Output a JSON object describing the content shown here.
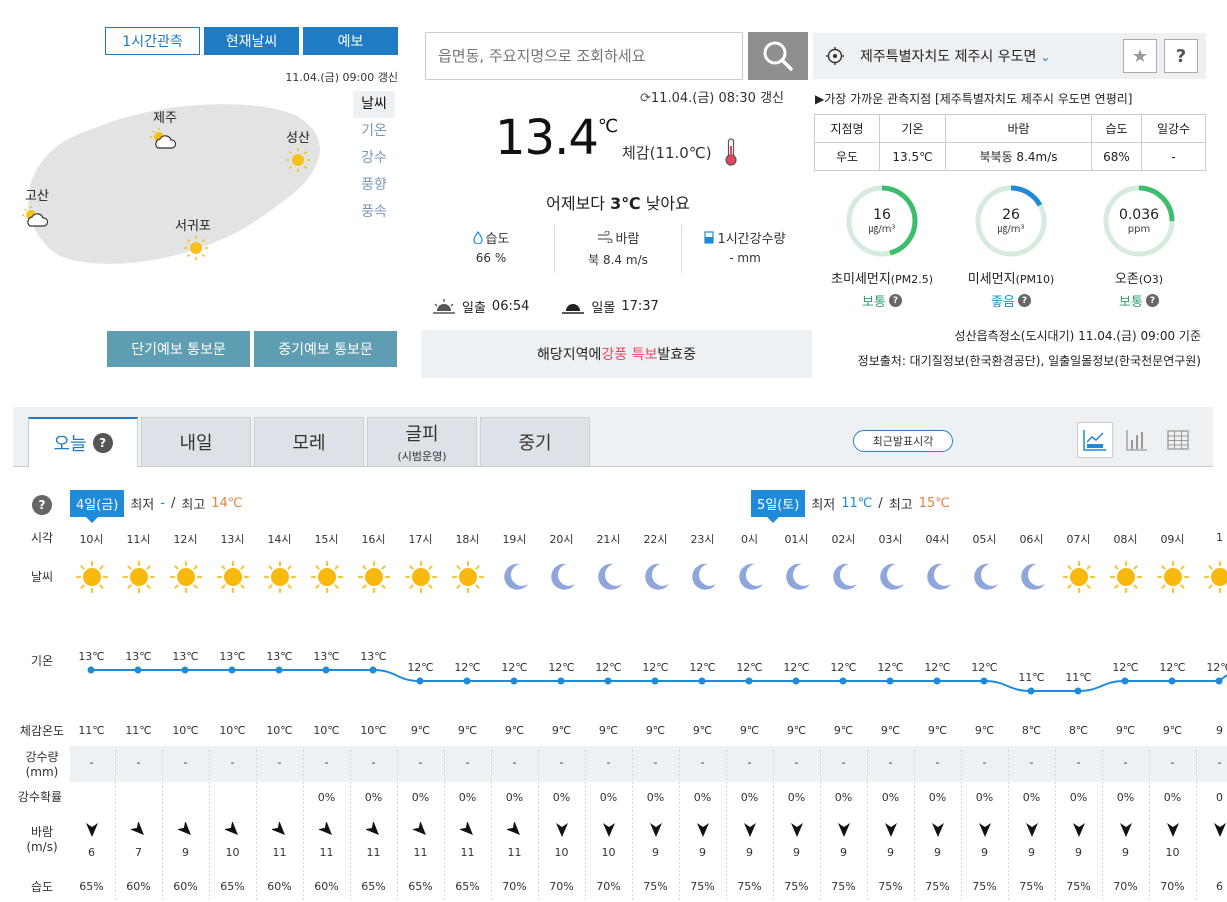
{
  "map": {
    "view_tabs": [
      "1시간관측",
      "현재날씨",
      "예보"
    ],
    "updated": "11.04.(금) 09:00 갱신",
    "locations": [
      {
        "name": "제주",
        "icon": "partly-cloudy-icon"
      },
      {
        "name": "성산",
        "icon": "sun-icon"
      },
      {
        "name": "고산",
        "icon": "partly-cloudy-icon"
      },
      {
        "name": "서귀포",
        "icon": "sun-icon"
      }
    ],
    "layers": [
      "날씨",
      "기온",
      "강수",
      "풍향",
      "풍속"
    ],
    "buttons": [
      "단기예보 통보문",
      "중기예보 통보문"
    ]
  },
  "search": {
    "placeholder": "읍면동, 주요지명으로 조회하세요"
  },
  "current": {
    "updated": "11.04.(금) 08:30 갱신",
    "temp": "13.4",
    "unit": "℃",
    "feels": "체감(11.0℃)",
    "compare_prefix": "어제보다 ",
    "compare_value": "3℃",
    "compare_suffix": " 낮아요",
    "metrics": [
      {
        "label": "습도",
        "value": "66 %",
        "icon": "drop-icon"
      },
      {
        "label": "바람",
        "value": "북 8.4 m/s",
        "icon": "wind-icon"
      },
      {
        "label": "1시간강수량",
        "value": "- mm",
        "icon": "rain-gauge-icon"
      }
    ],
    "sunrise_label": "일출",
    "sunrise": "06:54",
    "sunset_label": "일몰",
    "sunset": "17:37",
    "notice_prefix": "해당지역에 ",
    "notice_highlight": "강풍 특보",
    "notice_suffix": " 발효중"
  },
  "location_bar": {
    "name": "제주특별자치도 제주시 우도면",
    "star": "★",
    "help": "?"
  },
  "observation": {
    "nearest": "▶가장 가까운 관측지점 [제주특별자치도 제주시 우도면 연평리]",
    "headers": [
      "지점명",
      "기온",
      "바람",
      "습도",
      "일강수"
    ],
    "values": [
      "우도",
      "13.5℃",
      "북북동 8.4m/s",
      "68%",
      "-"
    ]
  },
  "air": [
    {
      "value": "16",
      "unit": "㎍/m³",
      "name": "초미세먼지",
      "sub": "(PM2.5)",
      "status": "보통",
      "status_color": "#2e9e6b",
      "ring_color": "#3ebd6d",
      "fraction": 0.46
    },
    {
      "value": "26",
      "unit": "㎍/m³",
      "name": "미세먼지",
      "sub": "(PM10)",
      "status": "좋음",
      "status_color": "#1e8ad8",
      "ring_color": "#1e8ad8",
      "fraction": 0.17
    },
    {
      "value": "0.036",
      "unit": "ppm",
      "name": "오존",
      "sub": "(O3)",
      "status": "보통",
      "status_color": "#2e9e6b",
      "ring_color": "#3ebd6d",
      "fraction": 0.25
    }
  ],
  "air_base": "성산읍측정소(도시대기) 11.04.(금) 09:00 기준",
  "air_source": "정보출처: 대기질정보(한국환경공단), 일출일몰정보(한국천문연구원)",
  "forecast_tabs": [
    {
      "label": "오늘",
      "sub": ""
    },
    {
      "label": "내일",
      "sub": ""
    },
    {
      "label": "모레",
      "sub": ""
    },
    {
      "label": "글피",
      "sub": "(시범운영)"
    },
    {
      "label": "중기",
      "sub": ""
    }
  ],
  "recent_button": "최근발표시각",
  "days": [
    {
      "label": "4일(금)",
      "min_label": "최저",
      "min": "-",
      "max_label": "최고",
      "max": "14℃"
    },
    {
      "label": "5일(토)",
      "min_label": "최저",
      "min": "11℃",
      "max_label": "최고",
      "max": "15℃"
    }
  ],
  "row_labels": {
    "time": "시각",
    "weather": "날씨",
    "temp": "기온",
    "feels": "체감온도",
    "rain": "강수량",
    "rain_unit": "(mm)",
    "prob": "강수확률",
    "wind": "바람",
    "wind_unit": "(m/s)",
    "humidity": "습도"
  },
  "hourly": {
    "hours": [
      "10시",
      "11시",
      "12시",
      "13시",
      "14시",
      "15시",
      "16시",
      "17시",
      "18시",
      "19시",
      "20시",
      "21시",
      "22시",
      "23시",
      "0시",
      "01시",
      "02시",
      "03시",
      "04시",
      "05시",
      "06시",
      "07시",
      "08시",
      "09시",
      "1"
    ],
    "icons": [
      "sun",
      "sun",
      "sun",
      "sun",
      "sun",
      "sun",
      "sun",
      "sun",
      "sun",
      "moon",
      "moon",
      "moon",
      "moon",
      "moon",
      "moon",
      "moon",
      "moon",
      "moon",
      "moon",
      "moon",
      "moon",
      "sun",
      "sun",
      "sun",
      "sun"
    ],
    "temps": [
      13,
      13,
      13,
      13,
      13,
      13,
      13,
      12,
      12,
      12,
      12,
      12,
      12,
      12,
      12,
      12,
      12,
      12,
      12,
      12,
      11,
      11,
      12,
      12,
      12
    ],
    "feels": [
      "11℃",
      "11℃",
      "10℃",
      "10℃",
      "10℃",
      "10℃",
      "10℃",
      "9℃",
      "9℃",
      "9℃",
      "9℃",
      "9℃",
      "9℃",
      "9℃",
      "9℃",
      "9℃",
      "9℃",
      "9℃",
      "9℃",
      "9℃",
      "8℃",
      "8℃",
      "9℃",
      "9℃",
      "9"
    ],
    "rain": [
      "-",
      "-",
      "-",
      "-",
      "-",
      "-",
      "-",
      "-",
      "-",
      "-",
      "-",
      "-",
      "-",
      "-",
      "-",
      "-",
      "-",
      "-",
      "-",
      "-",
      "-",
      "-",
      "-",
      "-",
      "-"
    ],
    "prob": [
      "",
      "",
      "",
      "",
      "",
      "0%",
      "0%",
      "0%",
      "0%",
      "0%",
      "0%",
      "0%",
      "0%",
      "0%",
      "0%",
      "0%",
      "0%",
      "0%",
      "0%",
      "0%",
      "0%",
      "0%",
      "0%",
      "0%",
      "0"
    ],
    "wind_dir": [
      "N",
      "NE",
      "NE",
      "NE",
      "NE",
      "NE",
      "NE",
      "NE",
      "NE",
      "NE",
      "N",
      "N",
      "N",
      "N",
      "N",
      "N",
      "N",
      "N",
      "N",
      "N",
      "N",
      "N",
      "N",
      "N",
      "N"
    ],
    "wind": [
      "6",
      "7",
      "9",
      "10",
      "11",
      "11",
      "11",
      "11",
      "11",
      "11",
      "10",
      "10",
      "9",
      "9",
      "9",
      "9",
      "9",
      "9",
      "9",
      "9",
      "9",
      "9",
      "9",
      "10",
      ""
    ],
    "humidity": [
      "65%",
      "60%",
      "60%",
      "65%",
      "60%",
      "60%",
      "65%",
      "65%",
      "65%",
      "70%",
      "70%",
      "70%",
      "75%",
      "75%",
      "75%",
      "75%",
      "75%",
      "75%",
      "75%",
      "75%",
      "75%",
      "75%",
      "70%",
      "70%",
      "6"
    ]
  },
  "colors": {
    "accent": "#1e7bc4",
    "line": "#1e8ad8"
  }
}
